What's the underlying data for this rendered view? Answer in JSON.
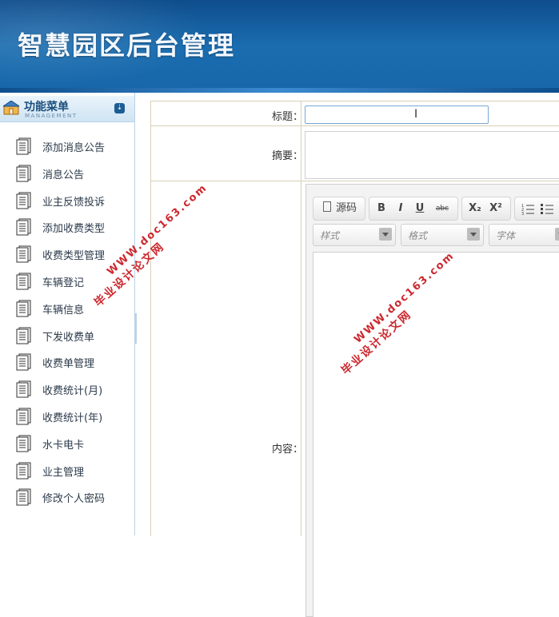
{
  "header": {
    "title": "智慧园区后台管理"
  },
  "sidebar": {
    "menu_title": "功能菜单",
    "menu_subtitle": "MANAGEMENT",
    "items": [
      {
        "label": "添加消息公告"
      },
      {
        "label": "消息公告"
      },
      {
        "label": "业主反馈投诉"
      },
      {
        "label": "添加收费类型"
      },
      {
        "label": "收费类型管理"
      },
      {
        "label": "车辆登记"
      },
      {
        "label": "车辆信息"
      },
      {
        "label": "下发收费单"
      },
      {
        "label": "收费单管理"
      },
      {
        "label": "收费统计(月)"
      },
      {
        "label": "收费统计(年)"
      },
      {
        "label": "水卡电卡"
      },
      {
        "label": "业主管理"
      },
      {
        "label": "修改个人密码"
      }
    ]
  },
  "form": {
    "title_label": "标题：",
    "summary_label": "摘要：",
    "content_label": "内容：",
    "title_value": "",
    "summary_value": ""
  },
  "editor": {
    "source_label": "源码",
    "bold": "B",
    "italic": "I",
    "underline": "U",
    "strike": "abc",
    "subscript": "X₂",
    "superscript": "X²",
    "style_placeholder": "样式",
    "format_placeholder": "格式",
    "font_placeholder": "字体"
  },
  "watermarks": [
    {
      "line1": "WWW.doc163.com",
      "line2": "毕业设计论文网"
    },
    {
      "line1": "WWW.doc163.com",
      "line2": "毕业设计论文网"
    }
  ],
  "colors": {
    "header_bg": "#1766a9",
    "watermark": "#c8161d",
    "menu_title": "#1b4f7e"
  }
}
